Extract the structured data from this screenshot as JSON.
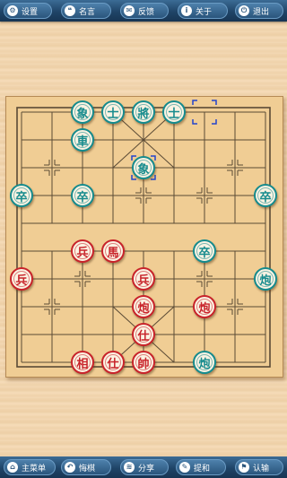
{
  "top_bar": [
    {
      "label": "设置",
      "icon": "⚙",
      "name": "settings-button",
      "icon_name": "gear-icon"
    },
    {
      "label": "名言",
      "icon": "❝",
      "name": "quotes-button",
      "icon_name": "speech-bubble-icon"
    },
    {
      "label": "反馈",
      "icon": "✉",
      "name": "feedback-button",
      "icon_name": "mail-icon"
    },
    {
      "label": "关于",
      "icon": "i",
      "name": "about-button",
      "icon_name": "info-icon"
    },
    {
      "label": "退出",
      "icon": "⏻",
      "name": "exit-button",
      "icon_name": "power-icon"
    }
  ],
  "bottom_bar": [
    {
      "label": "主菜单",
      "icon": "⌂",
      "name": "main-menu-button",
      "icon_name": "home-icon"
    },
    {
      "label": "悔棋",
      "icon": "↶",
      "name": "undo-button",
      "icon_name": "undo-icon"
    },
    {
      "label": "分享",
      "icon": "≋",
      "name": "share-button",
      "icon_name": "share-icon"
    },
    {
      "label": "提和",
      "icon": "✎",
      "name": "draw-offer-button",
      "icon_name": "pencil-icon"
    },
    {
      "label": "认输",
      "icon": "⚑",
      "name": "resign-button",
      "icon_name": "flag-icon"
    }
  ],
  "pieces": [
    {
      "char": "象",
      "side": "cyan",
      "col": 2,
      "row": 0
    },
    {
      "char": "士",
      "side": "cyan",
      "col": 3,
      "row": 0
    },
    {
      "char": "將",
      "side": "cyan",
      "col": 4,
      "row": 0
    },
    {
      "char": "士",
      "side": "cyan",
      "col": 5,
      "row": 0
    },
    {
      "char": "車",
      "side": "cyan",
      "col": 2,
      "row": 1
    },
    {
      "char": "象",
      "side": "cyan",
      "col": 4,
      "row": 2
    },
    {
      "char": "卒",
      "side": "cyan",
      "col": 0,
      "row": 3
    },
    {
      "char": "卒",
      "side": "cyan",
      "col": 2,
      "row": 3
    },
    {
      "char": "卒",
      "side": "cyan",
      "col": 8,
      "row": 3
    },
    {
      "char": "卒",
      "side": "cyan",
      "col": 6,
      "row": 5
    },
    {
      "char": "炮",
      "side": "cyan",
      "col": 8,
      "row": 6
    },
    {
      "char": "炮",
      "side": "cyan",
      "col": 6,
      "row": 9
    },
    {
      "char": "兵",
      "side": "red",
      "col": 2,
      "row": 5
    },
    {
      "char": "馬",
      "side": "red",
      "col": 3,
      "row": 5
    },
    {
      "char": "兵",
      "side": "red",
      "col": 0,
      "row": 6
    },
    {
      "char": "兵",
      "side": "red",
      "col": 4,
      "row": 6
    },
    {
      "char": "炮",
      "side": "red",
      "col": 4,
      "row": 7
    },
    {
      "char": "炮",
      "side": "red",
      "col": 6,
      "row": 7
    },
    {
      "char": "仕",
      "side": "red",
      "col": 4,
      "row": 8
    },
    {
      "char": "相",
      "side": "red",
      "col": 2,
      "row": 9
    },
    {
      "char": "仕",
      "side": "red",
      "col": 3,
      "row": 9
    },
    {
      "char": "帥",
      "side": "red",
      "col": 4,
      "row": 9
    }
  ],
  "last_move": {
    "from": {
      "col": 6,
      "row": 0
    },
    "to": {
      "col": 4,
      "row": 2
    }
  },
  "colors": {
    "red": "#c8232a",
    "cyan": "#168b8d",
    "grid": "#5a4a35",
    "highlight": "#2244cc"
  }
}
